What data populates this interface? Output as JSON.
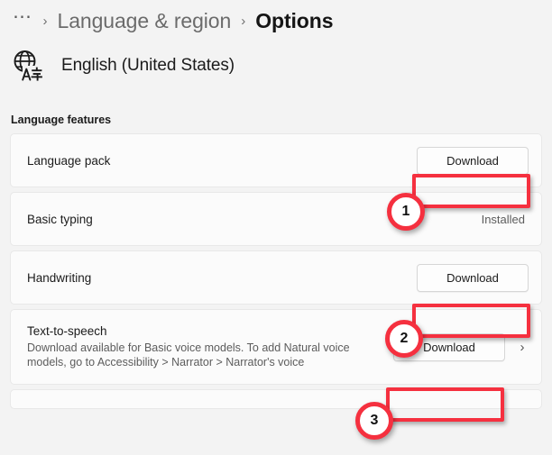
{
  "breadcrumb": {
    "ellipsis": "⋯",
    "separator": "›",
    "parent": "Language & region",
    "current": "Options"
  },
  "language_header": {
    "icon": "language-globe-icon",
    "name": "English (United States)"
  },
  "section": {
    "label": "Language features"
  },
  "rows": [
    {
      "title": "Language pack",
      "action_label": "Download",
      "status": null,
      "chevron": null
    },
    {
      "title": "Basic typing",
      "action_label": null,
      "status": "Installed",
      "chevron": null
    },
    {
      "title": "Handwriting",
      "action_label": "Download",
      "status": null,
      "chevron": null
    },
    {
      "title": "Text-to-speech",
      "description": "Download available for Basic voice models. To add Natural voice models, go to Accessibility > Narrator > Narrator's voice",
      "action_label": "Download",
      "status": null,
      "chevron": "›"
    }
  ],
  "annotations": {
    "accent_color": "#f5303f",
    "badges": [
      {
        "number": "1"
      },
      {
        "number": "2"
      },
      {
        "number": "3"
      }
    ]
  }
}
